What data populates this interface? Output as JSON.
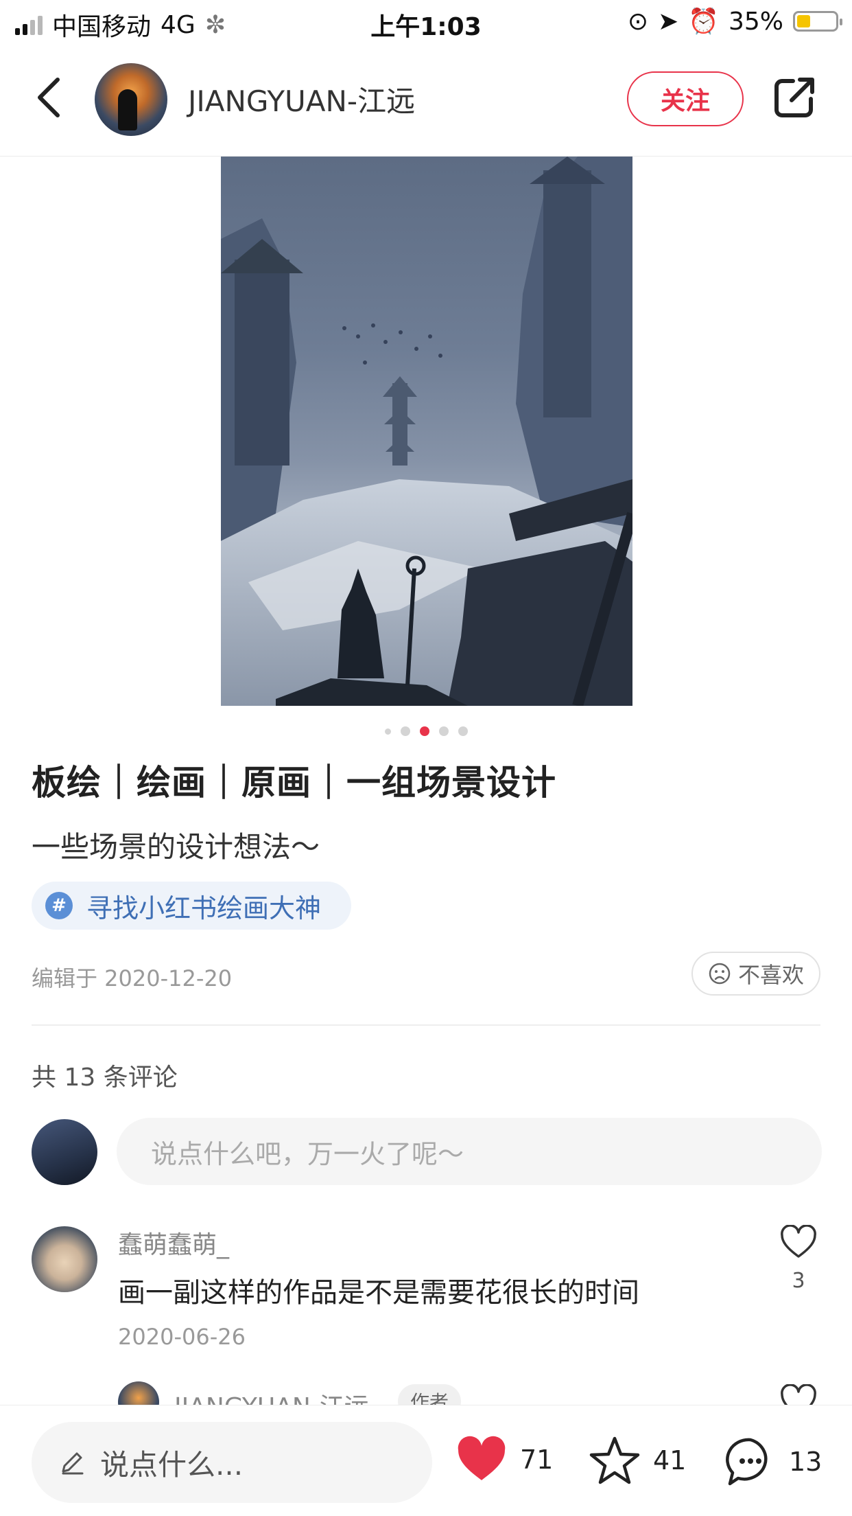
{
  "status_bar": {
    "carrier": "中国移动",
    "network": "4G",
    "time": "上午1:03",
    "battery": "35%",
    "battery_level": 0.35
  },
  "header": {
    "username": "JIANGYUAN-江远",
    "follow_label": "关注"
  },
  "carousel": {
    "total": 5,
    "current": 3
  },
  "post": {
    "title": "板绘｜绘画｜原画｜一组场景设计",
    "description": "一些场景的设计想法～",
    "tag_symbol": "#",
    "tag": "寻找小红书绘画大神",
    "edited": "编辑于 2020-12-20",
    "dislike_label": "不喜欢"
  },
  "comments": {
    "total_label": "共 13 条评论",
    "input_placeholder": "说点什么吧，万一火了呢～",
    "items": [
      {
        "author": "蠢萌蠢萌_",
        "text": "画一副这样的作品是不是需要花很长的时间",
        "date": "2020-06-26",
        "likes": "3"
      }
    ],
    "reply": {
      "author": "JIANGYUAN-江远",
      "badge": "作者"
    }
  },
  "bottom_bar": {
    "input_placeholder": "说点什么...",
    "likes": "71",
    "stars": "41",
    "comments": "13"
  },
  "colors": {
    "accent": "#e8334a",
    "tag_blue": "#3f6fb5"
  }
}
